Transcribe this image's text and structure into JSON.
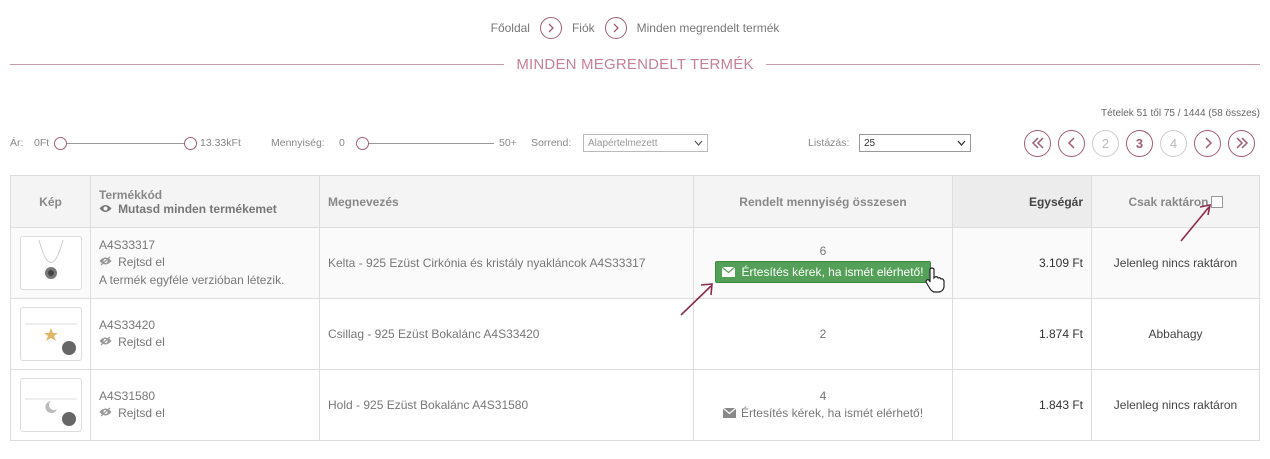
{
  "breadcrumb": [
    "Főoldal",
    "Fiók",
    "Minden megrendelt termék"
  ],
  "page_title": "MINDEN MEGRENDELT TERMÉK",
  "items_info": "Tételek 51 től 75 / 1444 (58 összes)",
  "filters": {
    "price_label": "Ár:",
    "price_min": "0Ft",
    "price_max": "13.33kFt",
    "qty_label": "Mennyiség:",
    "qty_min": "0",
    "qty_max": "50+",
    "sort_label": "Sorrend:",
    "sort_value": "Alapértelmezett",
    "list_label": "Listázás:",
    "list_value": "25"
  },
  "pagination": {
    "pages": [
      "2",
      "3",
      "4"
    ],
    "current": "3"
  },
  "table": {
    "headers": {
      "image": "Kép",
      "code": "Termékkód",
      "show_all": "Mutasd minden termékemet",
      "name": "Megnevezés",
      "qty": "Rendelt mennyiség összesen",
      "price": "Egységár",
      "stock_only": "Csak raktáron"
    },
    "rows": [
      {
        "code": "A4S33317",
        "hide": "Rejtsd el",
        "note": "A termék egyféle verzióban létezik.",
        "name": "Kelta - 925 Ezüst Cirkónia és kristály nyakláncok A4S33317",
        "qty": "6",
        "notify": "Értesítés kérek, ha ismét elérhető!",
        "price": "3.109 Ft",
        "stock": "Jelenleg nincs raktáron"
      },
      {
        "code": "A4S33420",
        "hide": "Rejtsd el",
        "note": "",
        "name": "Csillag - 925 Ezüst Bokalánc A4S33420",
        "qty": "2",
        "notify": "",
        "price": "1.874 Ft",
        "stock": "Abbahagy"
      },
      {
        "code": "A4S31580",
        "hide": "Rejtsd el",
        "note": "",
        "name": "Hold - 925 Ezüst Bokalánc A4S31580",
        "qty": "4",
        "notify": "Értesítés kérek, ha ismét elérhető!",
        "price": "1.843 Ft",
        "stock": "Jelenleg nincs raktáron"
      }
    ]
  },
  "colors": {
    "accent": "#a35c76",
    "button_green": "#55a058"
  }
}
